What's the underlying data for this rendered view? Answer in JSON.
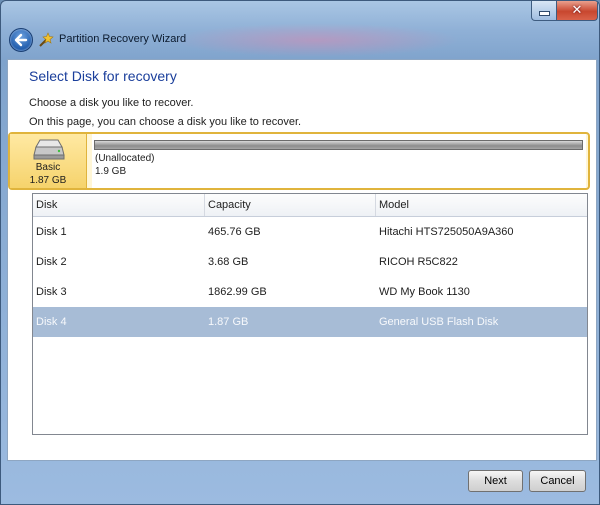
{
  "window": {
    "title": "Partition Recovery Wizard",
    "minimize_icon": "minimize-icon",
    "close_icon": "close-icon",
    "back_icon": "back-arrow-icon"
  },
  "page": {
    "heading": "Select Disk for recovery",
    "instruction": "Choose a disk you like to recover.",
    "description": "On this page, you can choose a disk you like to recover."
  },
  "disk_map": {
    "disk_type": "Basic",
    "disk_size": "1.87 GB",
    "partition_name": "(Unallocated)",
    "partition_size": "1.9 GB"
  },
  "table": {
    "columns": [
      "Disk",
      "Capacity",
      "Model"
    ],
    "rows": [
      {
        "disk": "Disk 1",
        "capacity": "465.76 GB",
        "model": "Hitachi HTS725050A9A360",
        "selected": false
      },
      {
        "disk": "Disk 2",
        "capacity": "3.68 GB",
        "model": "RICOH R5C822",
        "selected": false
      },
      {
        "disk": "Disk 3",
        "capacity": "1862.99 GB",
        "model": "WD My Book 1130",
        "selected": false
      },
      {
        "disk": "Disk 4",
        "capacity": "1.87 GB",
        "model": "General USB Flash Disk",
        "selected": true
      }
    ]
  },
  "buttons": {
    "next": "Next",
    "cancel": "Cancel"
  },
  "colors": {
    "heading": "#1a3e9b",
    "selection": "#a7bcd6",
    "disk_highlight": "#e0b43c"
  }
}
